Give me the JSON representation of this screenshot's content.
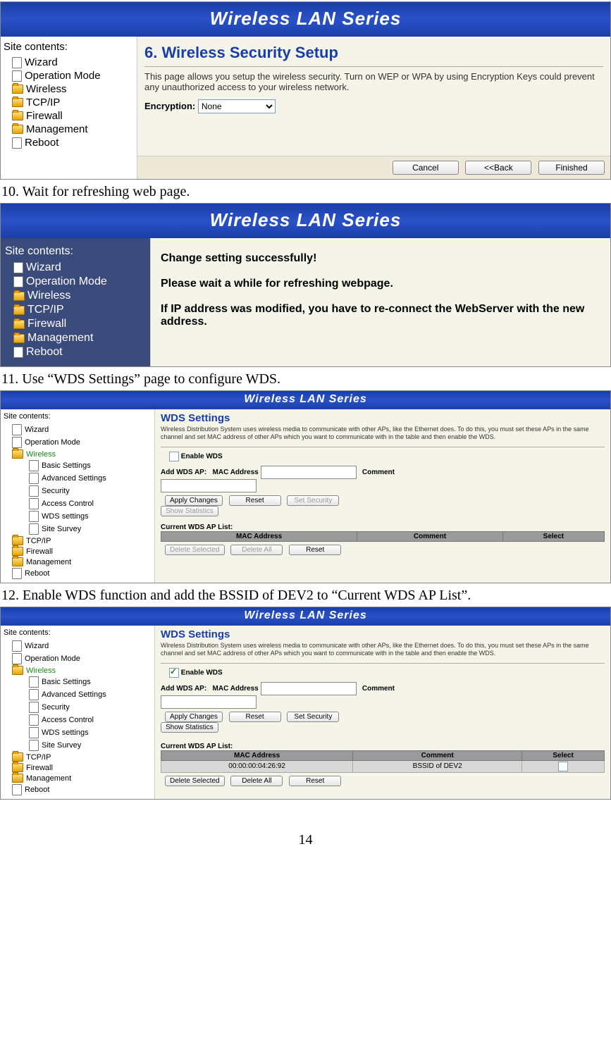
{
  "banner_title": "Wireless LAN Series",
  "sidebar_title": "Site contents:",
  "sidebar_items_basic": [
    "Wizard",
    "Operation Mode",
    "Wireless",
    "TCP/IP",
    "Firewall",
    "Management",
    "Reboot"
  ],
  "sidebar_items_expanded": {
    "top": [
      "Wizard",
      "Operation Mode"
    ],
    "wireless": "Wireless",
    "wireless_sub": [
      "Basic Settings",
      "Advanced Settings",
      "Security",
      "Access Control",
      "WDS settings",
      "Site Survey"
    ],
    "rest": [
      "TCP/IP",
      "Firewall",
      "Management",
      "Reboot"
    ]
  },
  "shot1": {
    "title": "6. Wireless Security Setup",
    "desc": "This page allows you setup the wireless security. Turn on WEP or WPA by using Encryption Keys could prevent any unauthorized access to your wireless network.",
    "enc_label": "Encryption:",
    "enc_value": "None",
    "btn_cancel": "Cancel",
    "btn_back": "<<Back",
    "btn_finished": "Finished"
  },
  "step10": "10. Wait for refreshing web page.",
  "shot2": {
    "l1": "Change setting successfully!",
    "l2": "Please wait a while for refreshing webpage.",
    "l3": "If IP address was modified, you have to re-connect the WebServer with the new address."
  },
  "step11": "11. Use “WDS Settings” page to configure WDS.",
  "wds": {
    "title": "WDS Settings",
    "desc": "Wireless Distribution System uses wireless media to communicate with other APs, like the Ethernet does. To do this, you must set these APs in the same channel and set MAC address of other APs which you want to communicate with in the table and then enable the WDS.",
    "enable_label": "Enable WDS",
    "add_label": "Add WDS AP:",
    "mac_label": "MAC Address",
    "comment_label": "Comment",
    "btn_apply": "Apply Changes",
    "btn_reset": "Reset",
    "btn_setsec": "Set Security",
    "btn_showstat": "Show Statistics",
    "list_title": "Current WDS AP List:",
    "col_mac": "MAC Address",
    "col_comment": "Comment",
    "col_select": "Select",
    "btn_delsel": "Delete Selected",
    "btn_delall": "Delete All",
    "btn_reset2": "Reset"
  },
  "step12": "12. Enable WDS function and add the BSSID of DEV2 to “Current WDS AP List”.",
  "wds_row": {
    "mac": "00:00:00:04:26:92",
    "comment": "BSSID of DEV2"
  },
  "page_number": "14"
}
